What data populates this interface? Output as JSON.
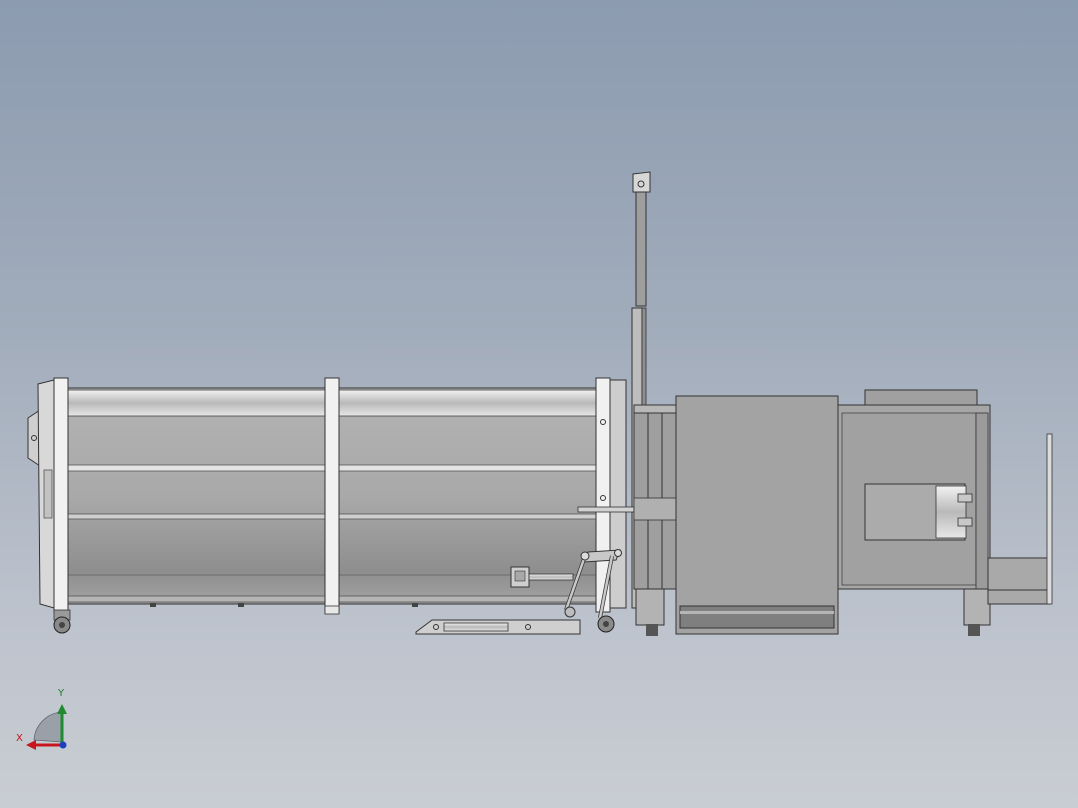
{
  "axis_triad": {
    "x_label": "X",
    "y_label": "Y",
    "x_color": "#c8161e",
    "y_color": "#1f8a2f",
    "z_color": "#1d3fbf"
  },
  "background": {
    "top_color": "#8c9bb0",
    "bottom_color": "#c9cdd3"
  }
}
